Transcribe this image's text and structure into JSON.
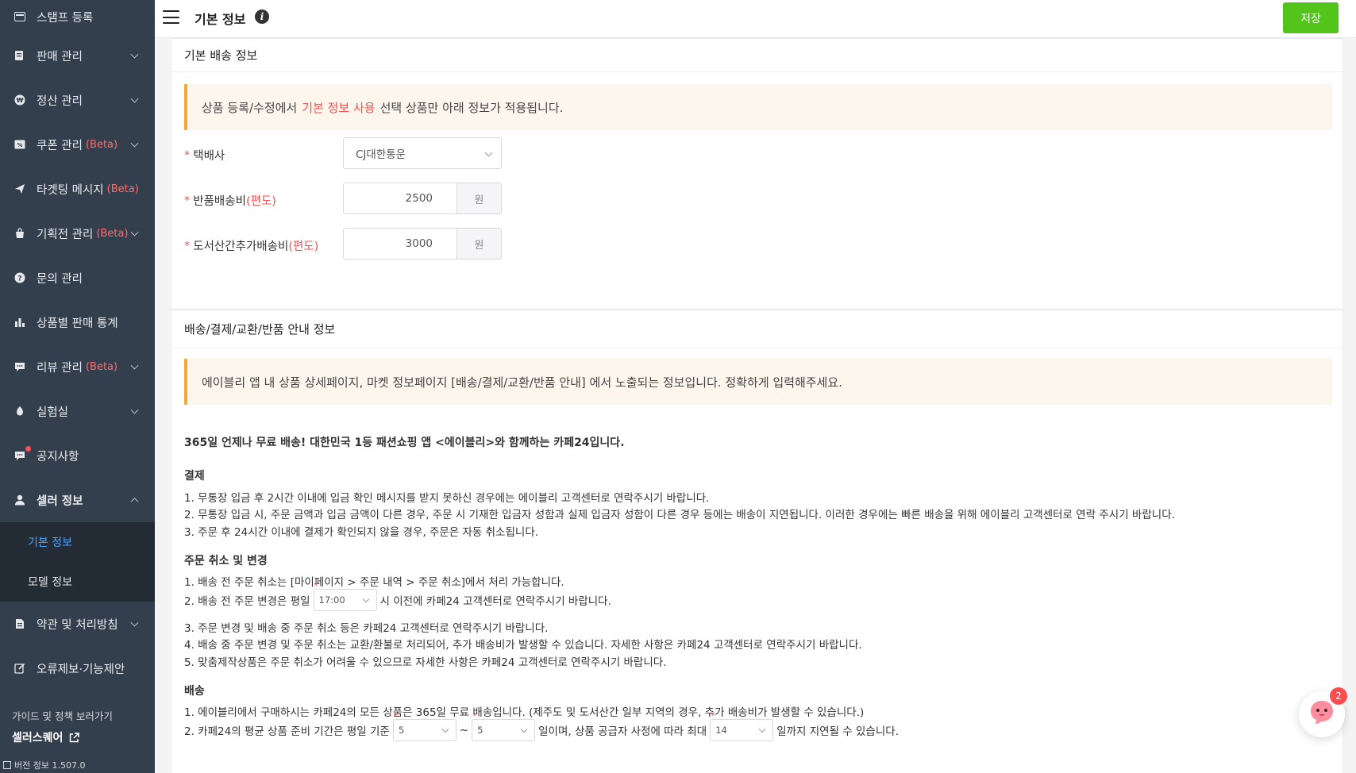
{
  "sidebar": {
    "items": [
      {
        "label": "스탬프 등록",
        "icon": "stamp-icon",
        "beta": ""
      },
      {
        "label": "판매 관리",
        "icon": "sales-icon",
        "beta": ""
      },
      {
        "label": "정산 관리",
        "icon": "settlement-icon",
        "beta": ""
      },
      {
        "label": "쿠폰 관리",
        "icon": "coupon-icon",
        "beta": "(Beta)"
      },
      {
        "label": "타겟팅 메시지",
        "icon": "send-icon",
        "beta": "(Beta)"
      },
      {
        "label": "기획전 관리",
        "icon": "bag-icon",
        "beta": "(Beta)"
      },
      {
        "label": "문의 관리",
        "icon": "question-icon",
        "beta": ""
      },
      {
        "label": "상품별 판매 통계",
        "icon": "bar-chart-icon",
        "beta": ""
      },
      {
        "label": "리뷰 관리",
        "icon": "comment-icon",
        "beta": "(Beta)"
      },
      {
        "label": "실험실",
        "icon": "flask-icon",
        "beta": ""
      },
      {
        "label": "공지사항",
        "icon": "chat-icon",
        "beta": ""
      },
      {
        "label": "셀러 정보",
        "icon": "user-icon",
        "beta": ""
      }
    ],
    "sub_items": [
      "기본 정보",
      "모델 정보"
    ],
    "bottom_items": [
      {
        "label": "약관 및 처리방침",
        "icon": "document-icon"
      },
      {
        "label": "오류제보·기능제안",
        "icon": "edit-icon"
      }
    ],
    "guide": "가이드 및 정책 보러가기",
    "seller_square": "셀러스퀘어",
    "version": "버전 정보 1.507.0"
  },
  "header": {
    "title": "기본 정보",
    "save_label": "저장"
  },
  "shipping": {
    "title": "기본 배송 정보",
    "notice_pre": "상품 등록/수정에서",
    "notice_hl": "기본 정보 사용",
    "notice_post": "선택 상품만 아래 정보가 적용됩니다.",
    "courier_label": "택배사",
    "courier_value": "CJ대한통운",
    "return_label": "반품배송비",
    "return_suffix": "(편도)",
    "return_value": "2500",
    "island_label": "도서산간추가배송비",
    "island_suffix": "(편도)",
    "island_value": "3000",
    "unit": "원"
  },
  "guide_info": {
    "title": "배송/결제/교환/반품 안내 정보",
    "notice": "에이블리 앱 내 상품 상세페이지, 마켓 정보페이지 [배송/결제/교환/반품 안내] 에서 노출되는 정보입니다. 정확하게 입력해주세요.",
    "headline": "365일 언제나 무료 배송! 대한민국 1등 패션쇼핑 앱 <에이블리>와 함께하는 카페24입니다.",
    "payment_title": "결제",
    "payment_lines": [
      "1. 무통장 입금 후 2시간 이내에 입금 확인 메시지를 받지 못하신 경우에는 에이블리 고객센터로 연락주시기 바랍니다.",
      "2. 무통장 입금 시, 주문 금액과 입금 금액이 다른 경우, 주문 시 기재한 입금자 성함과 실제 입금자 성함이 다른 경우 등에는 배송이 지연됩니다. 이러한 경우에는 빠른 배송을 위해 에이블리 고객센터로 연락 주시기 바랍니다.",
      "3. 주문 후 24시간 이내에 결제가 확인되지 않을 경우, 주문은 자동 취소됩니다."
    ],
    "order_title": "주문 취소 및 변경",
    "order_line1": "1. 배송 전 주문 취소는 [마이페이지 > 주문 내역 > 주문 취소]에서 처리 가능합니다.",
    "order_line2_pre": "2. 배송 전 주문 변경은 평일",
    "order_time": "17:00",
    "order_line2_post": "시 이전에 카페24 고객센터로 연락주시기 바랍니다.",
    "order_lines_rest": [
      "3. 주문 변경 및 배송 중 주문 취소 등은 카페24 고객센터로 연락주시기 바랍니다.",
      "4. 배송 중 주문 변경 및 주문 취소는 교환/환불로 처리되어, 추가 배송비가 발생할 수 있습니다. 자세한 사항은 카페24 고객센터로 연락주시기 바랍니다.",
      "5. 맞춤제작상품은 주문 취소가 어려울 수 있으므로 자세한 사항은 카페24 고객센터로 연락주시기 바랍니다."
    ],
    "delivery_title": "배송",
    "delivery_line1": "1. 에이블리에서 구매하시는 카페24의 모든 상품은 365일 무료 배송입니다. (제주도 및 도서산간 일부 지역의 경우, 추가 배송비가 발생할 수 있습니다.)",
    "delivery_line2_pre": "2. 카페24의 평균 상품 준비 기간은 평일 기준",
    "prep_min": "5",
    "tilde": "~",
    "prep_max": "5",
    "delivery_line2_mid": "일이며, 상품 공급자 사정에 따라 최대",
    "prep_delay": "14",
    "delivery_line2_post": "일까지 지연될 수 있습니다."
  },
  "chat": {
    "badge": "2"
  },
  "colors": {
    "sidebar_bg": "#343f4e",
    "submenu_bg": "#232b35",
    "active_link": "#4aa3ff",
    "save_green": "#52c41a",
    "accent_red": "#ff4d4f",
    "notice_border": "#f0a73c"
  }
}
